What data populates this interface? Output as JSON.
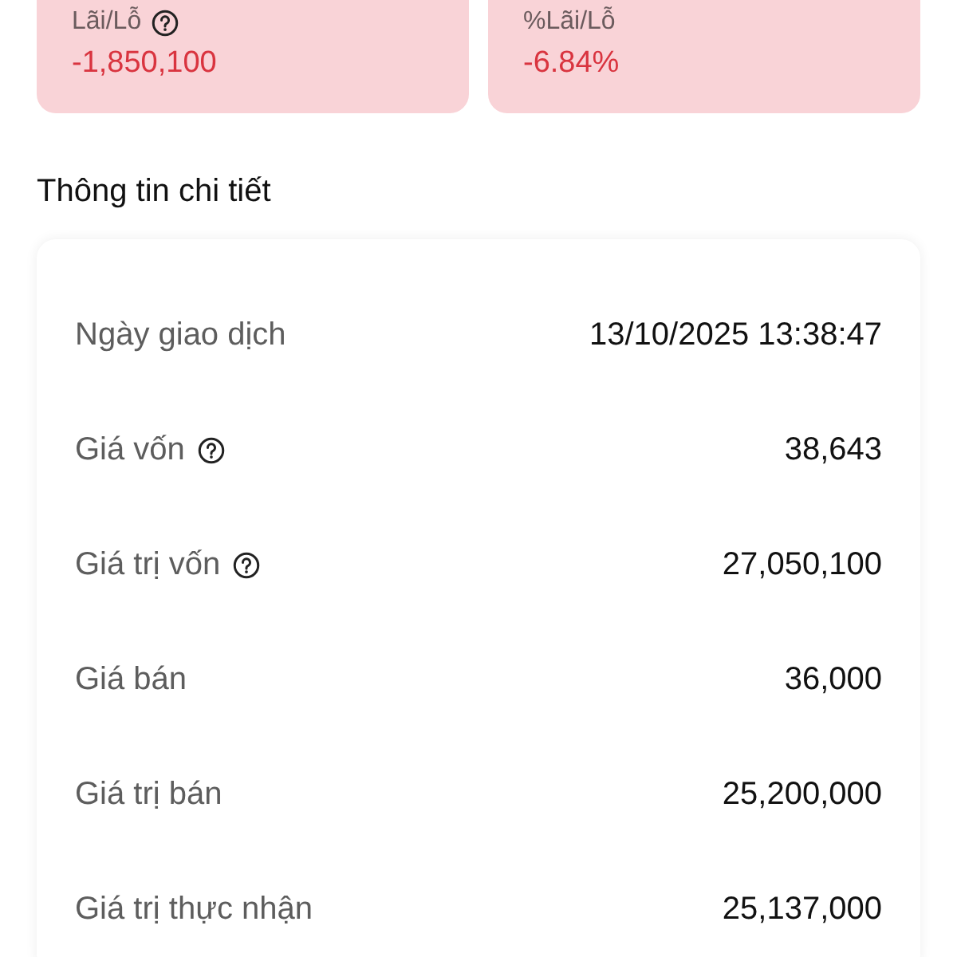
{
  "summary": [
    {
      "label": "Lãi/Lỗ",
      "has_help": true,
      "value": "-1,850,100",
      "color": "#d9343f"
    },
    {
      "label": "%Lãi/Lỗ",
      "has_help": false,
      "value": "-6.84%",
      "color": "#d9343f"
    }
  ],
  "details": {
    "title": "Thông tin chi tiết",
    "rows": [
      {
        "label": "Ngày giao dịch",
        "has_help": false,
        "value": "13/10/2025 13:38:47"
      },
      {
        "label": "Giá vốn",
        "has_help": true,
        "value": "38,643"
      },
      {
        "label": "Giá trị vốn",
        "has_help": true,
        "value": "27,050,100"
      },
      {
        "label": "Giá bán",
        "has_help": false,
        "value": "36,000"
      },
      {
        "label": "Giá trị bán",
        "has_help": false,
        "value": "25,200,000"
      },
      {
        "label": "Giá trị thực nhận",
        "has_help": false,
        "value": "25,137,000"
      }
    ]
  }
}
